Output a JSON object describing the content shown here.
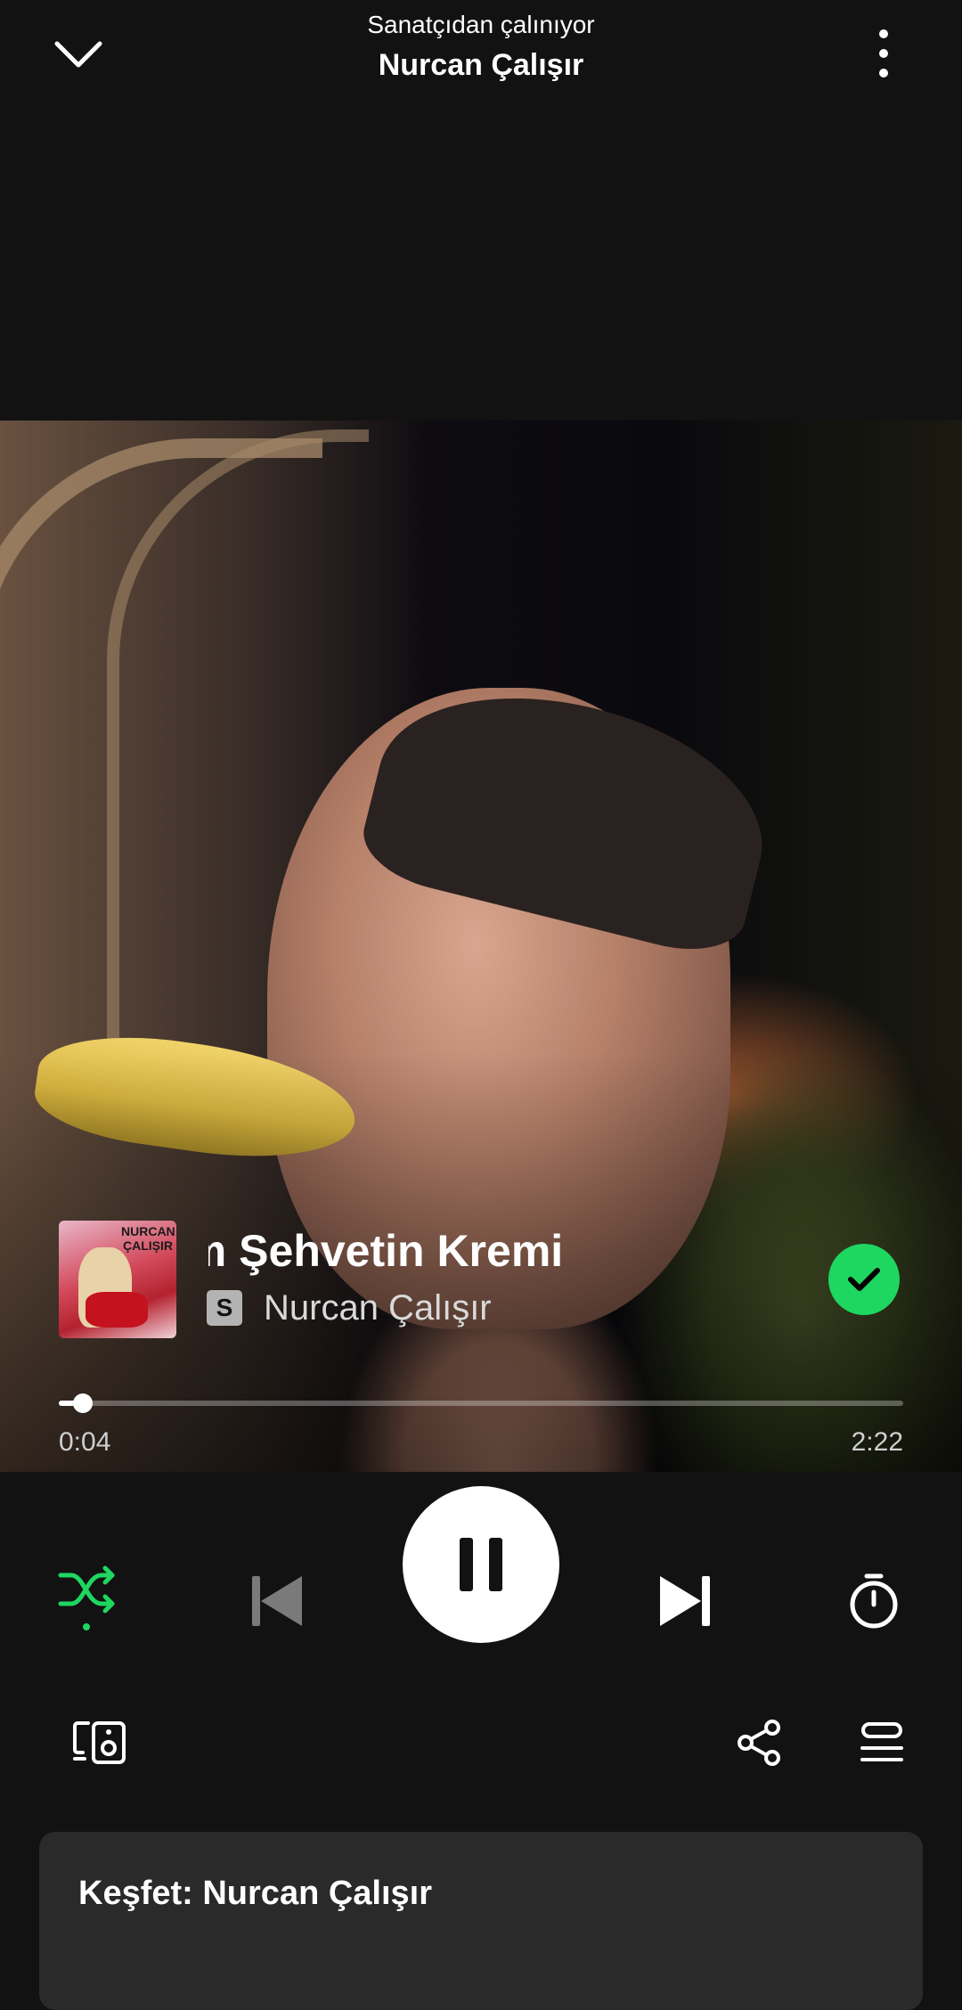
{
  "header": {
    "context_label": "Sanatçıdan çalınıyor",
    "context_title": "Nurcan Çalışır",
    "collapse_icon": "chevron-down-icon",
    "more_icon": "more-vertical-icon"
  },
  "album_art": {
    "title_text": "NURCAN ÇALIŞIR"
  },
  "track": {
    "title": "Şampanyam Şehvetin Kremi",
    "title_visible": "am Şehvetin Kremi",
    "artist": "Nurcan Çalışır",
    "sample_badge": "S",
    "liked": true
  },
  "progress": {
    "elapsed": "0:04",
    "duration": "2:22",
    "fraction": 0.028
  },
  "controls": {
    "shuffle_active": true,
    "playing": true,
    "icons": [
      "shuffle-icon",
      "skip-back-icon",
      "pause-icon",
      "skip-forward-icon",
      "sleep-timer-icon"
    ]
  },
  "bottom_row": {
    "icons": [
      "devices-icon",
      "share-icon",
      "queue-icon"
    ]
  },
  "explore": {
    "title": "Keşfet: Nurcan Çalışır"
  },
  "colors": {
    "background": "#121212",
    "accent": "#1ed760",
    "card": "#2a2a2a"
  }
}
